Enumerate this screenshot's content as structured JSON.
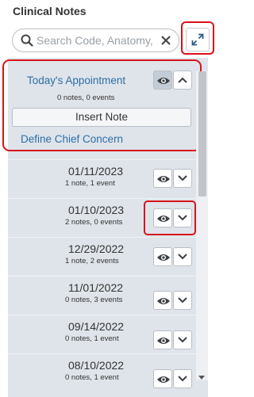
{
  "panel": {
    "title": "Clinical Notes"
  },
  "search": {
    "placeholder": "Search Code, Anatomy,",
    "value": ""
  },
  "today": {
    "title": "Today's Appointment",
    "counts": "0 notes,  0 events",
    "insert_label": "Insert Note",
    "chief_label": "Define Chief Concern"
  },
  "rows": [
    {
      "date": "01/11/2023",
      "counts": "1 note,  1 event"
    },
    {
      "date": "01/10/2023",
      "counts": "2 notes,  0 events"
    },
    {
      "date": "12/29/2022",
      "counts": "1 note,  2 events"
    },
    {
      "date": "11/01/2022",
      "counts": "0 notes,  3 events"
    },
    {
      "date": "09/14/2022",
      "counts": "0 notes,  1 event"
    },
    {
      "date": "08/10/2022",
      "counts": "0 notes,  1 event"
    }
  ],
  "colors": {
    "highlight": "#d9121b",
    "link": "#2c6ea6",
    "list_bg": "#dfe4ea"
  },
  "icons": [
    "search-icon",
    "close-icon",
    "expand-icon",
    "eye-icon",
    "chevron-up-icon",
    "chevron-down-icon"
  ]
}
